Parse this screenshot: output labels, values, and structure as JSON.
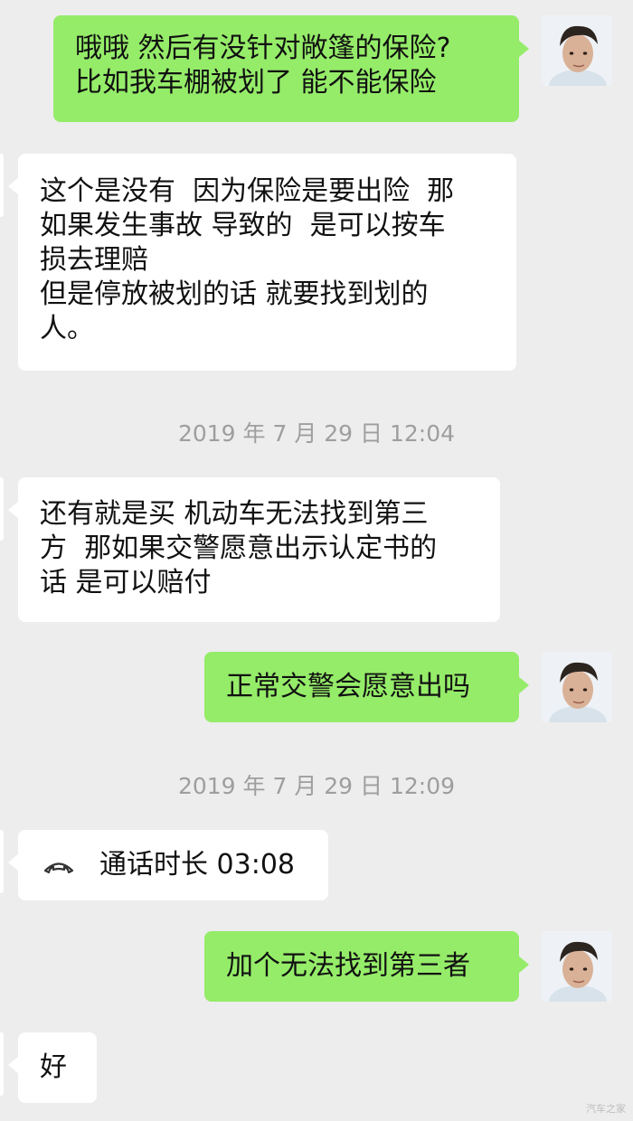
{
  "messages": [
    {
      "text": "哦哦 然后有没针对敞篷的保险?\n比如我车棚被划了 能不能保险"
    },
    {
      "text": "这个是没有  因为保险是要出险  那\n如果发生事故 导致的  是可以按车\n损去理赔\n但是停放被划的话 就要找到划的\n人。"
    },
    {
      "text": "2019 年 7 月 29 日 12:04"
    },
    {
      "text": "还有就是买 机动车无法找到第三\n方  那如果交警愿意出示认定书的\n话 是可以赔付"
    },
    {
      "text": "正常交警会愿意出吗"
    },
    {
      "text": "2019 年 7 月 29 日 12:09"
    },
    {
      "text": "通话时长 03:08",
      "icon": "phone-hangup-icon"
    },
    {
      "text": "加个无法找到第三者"
    },
    {
      "text": "好"
    }
  ],
  "watermark": "汽车之家",
  "colors": {
    "background": "#ededed",
    "outgoing_bubble": "#95ec69",
    "incoming_bubble": "#ffffff",
    "timestamp_text": "#9e9e9e",
    "message_text": "#111111"
  }
}
